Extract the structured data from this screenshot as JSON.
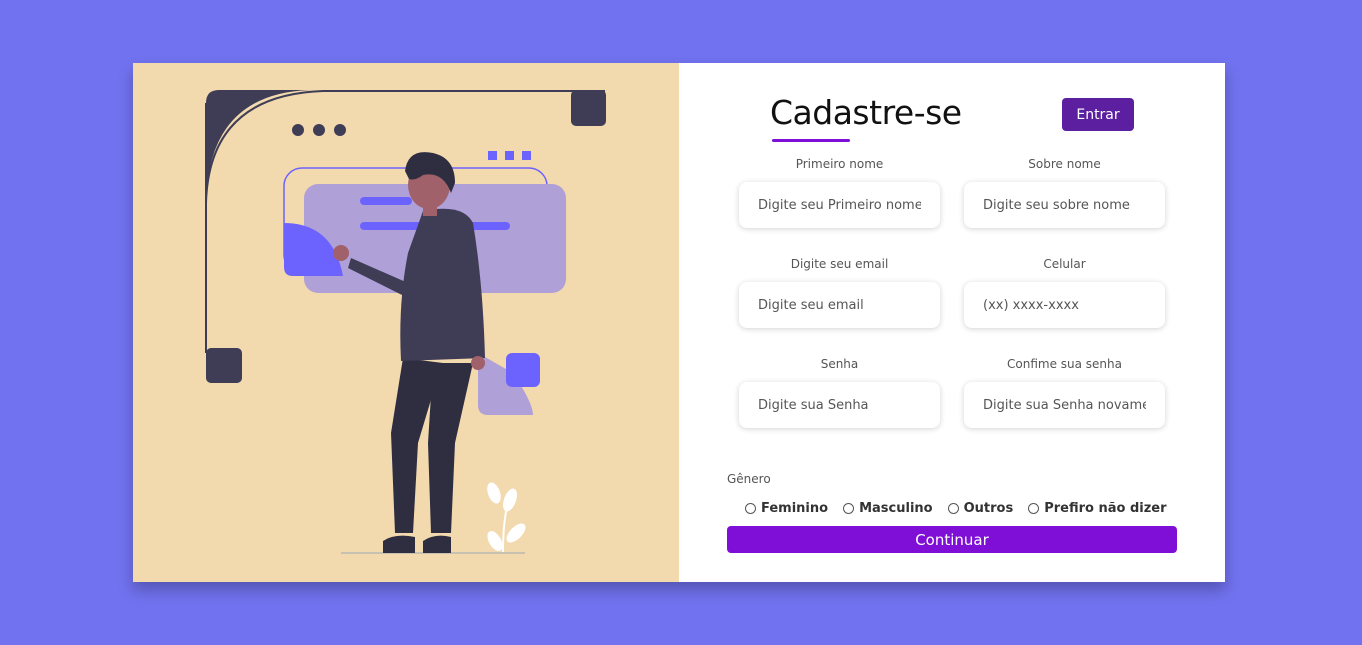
{
  "form": {
    "title": "Cadastre-se",
    "login_button": "Entrar",
    "fields": [
      {
        "label": "Primeiro nome",
        "placeholder": "Digite seu Primeiro nome"
      },
      {
        "label": "Sobre nome",
        "placeholder": "Digite seu sobre nome"
      },
      {
        "label": "Digite seu email",
        "placeholder": "Digite seu email"
      },
      {
        "label": "Celular",
        "placeholder": "(xx) xxxx-xxxx"
      },
      {
        "label": "Senha",
        "placeholder": "Digite sua Senha"
      },
      {
        "label": "Confime sua senha",
        "placeholder": "Digite sua Senha novamente"
      }
    ],
    "gender": {
      "label": "Gênero",
      "options": [
        "Feminino",
        "Masculino",
        "Outros",
        "Prefiro não dizer"
      ]
    },
    "continue_button": "Continuar"
  },
  "colors": {
    "background": "#7172ef",
    "illustration_bg": "#f2d9ae",
    "accent": "#7f0fd6",
    "login_button": "#5b1fa0",
    "illustration_dark": "#3f3d56",
    "illustration_purple": "#6c63ff",
    "illustration_lavender": "#b0a0d8"
  },
  "illustration": {
    "name": "person-at-screen-illustration"
  }
}
